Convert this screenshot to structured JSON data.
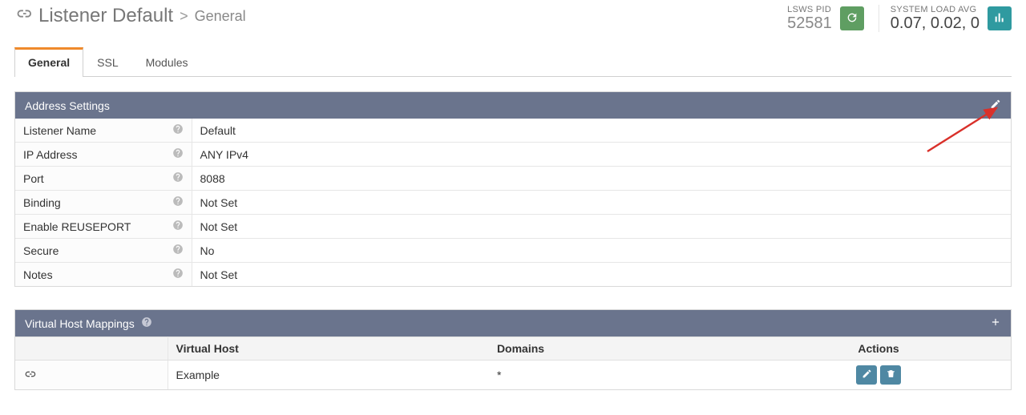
{
  "header": {
    "title_main": "Listener Default",
    "title_sub": "General",
    "pid_label": "LSWS PID",
    "pid_value": "52581",
    "load_label": "SYSTEM LOAD AVG",
    "load_value": "0.07, 0.02, 0"
  },
  "tabs": [
    {
      "label": "General",
      "active": true
    },
    {
      "label": "SSL",
      "active": false
    },
    {
      "label": "Modules",
      "active": false
    }
  ],
  "address_panel": {
    "title": "Address Settings",
    "rows": [
      {
        "label": "Listener Name",
        "value": "Default",
        "not_set": false
      },
      {
        "label": "IP Address",
        "value": "ANY IPv4",
        "not_set": false
      },
      {
        "label": "Port",
        "value": "8088",
        "not_set": false
      },
      {
        "label": "Binding",
        "value": "Not Set",
        "not_set": true
      },
      {
        "label": "Enable REUSEPORT",
        "value": "Not Set",
        "not_set": true
      },
      {
        "label": "Secure",
        "value": "No",
        "not_set": false
      },
      {
        "label": "Notes",
        "value": "Not Set",
        "not_set": true
      }
    ]
  },
  "vhost_panel": {
    "title": "Virtual Host Mappings",
    "columns": {
      "vhost": "Virtual Host",
      "domains": "Domains",
      "actions": "Actions"
    },
    "rows": [
      {
        "vhost": "Example",
        "domains": "*"
      }
    ]
  }
}
